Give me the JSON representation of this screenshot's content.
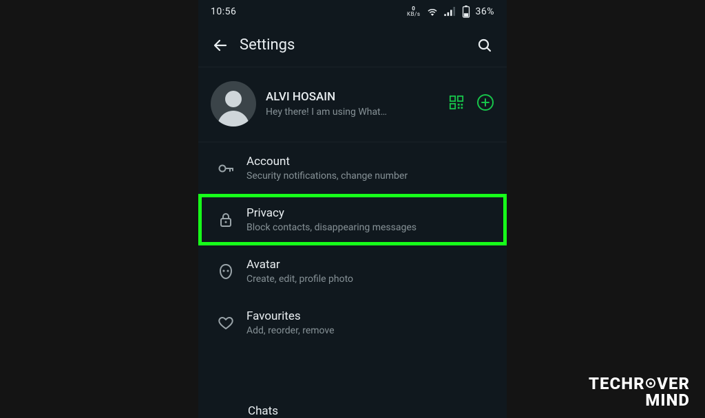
{
  "status": {
    "time": "10:56",
    "data_rate": "0",
    "data_unit": "KB/s",
    "battery": "36%"
  },
  "appbar": {
    "title": "Settings"
  },
  "profile": {
    "name": "ALVI HOSAIN",
    "status": "Hey there! I am using What…"
  },
  "rows": [
    {
      "title": "Account",
      "sub": "Security notifications, change number"
    },
    {
      "title": "Privacy",
      "sub": "Block contacts, disappearing messages"
    },
    {
      "title": "Avatar",
      "sub": "Create, edit, profile photo"
    },
    {
      "title": "Favourites",
      "sub": "Add, reorder, remove"
    },
    {
      "title": "Chats",
      "sub": ""
    }
  ],
  "watermark": {
    "line1_a": "TECHR",
    "line1_b": "VER",
    "line2": "MIND"
  }
}
